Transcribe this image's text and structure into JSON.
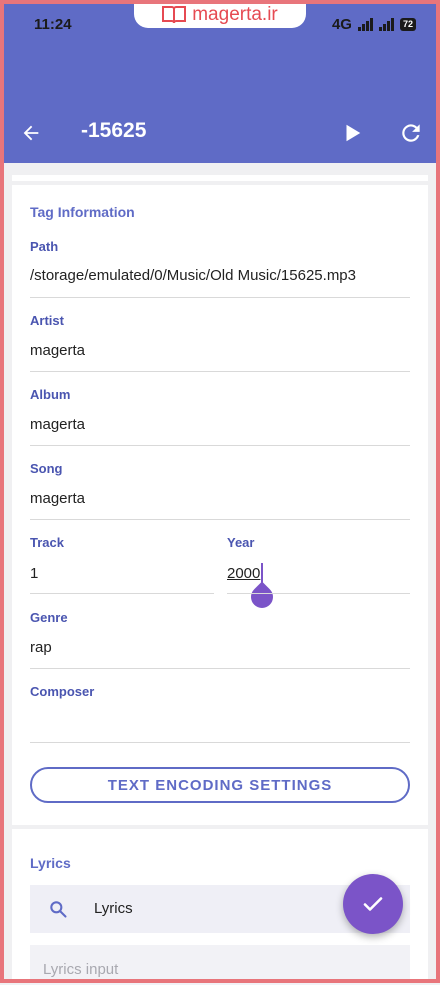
{
  "status_bar": {
    "time": "11:24",
    "network": "4G",
    "battery": "72"
  },
  "watermark": {
    "text": "magerta.ir"
  },
  "app_bar": {
    "title": "-15625",
    "back_icon": "arrow-left-icon",
    "play_icon": "play-icon",
    "refresh_icon": "refresh-icon"
  },
  "tag_info": {
    "section_title": "Tag Information",
    "path": {
      "label": "Path",
      "value": "/storage/emulated/0/Music/Old Music/15625.mp3"
    },
    "artist": {
      "label": "Artist",
      "value": "magerta"
    },
    "album": {
      "label": "Album",
      "value": "magerta"
    },
    "song": {
      "label": "Song",
      "value": "magerta"
    },
    "track": {
      "label": "Track",
      "value": "1"
    },
    "year": {
      "label": "Year",
      "value": "2000"
    },
    "genre": {
      "label": "Genre",
      "value": "rap"
    },
    "composer": {
      "label": "Composer",
      "value": ""
    },
    "encoding_button": "TEXT ENCODING SETTINGS"
  },
  "lyrics": {
    "section_title": "Lyrics",
    "search_label": "Lyrics",
    "input_placeholder": "Lyrics input"
  },
  "colors": {
    "accent": "#5f6bc6",
    "fab": "#7b54c8",
    "frame": "#e8757b"
  }
}
